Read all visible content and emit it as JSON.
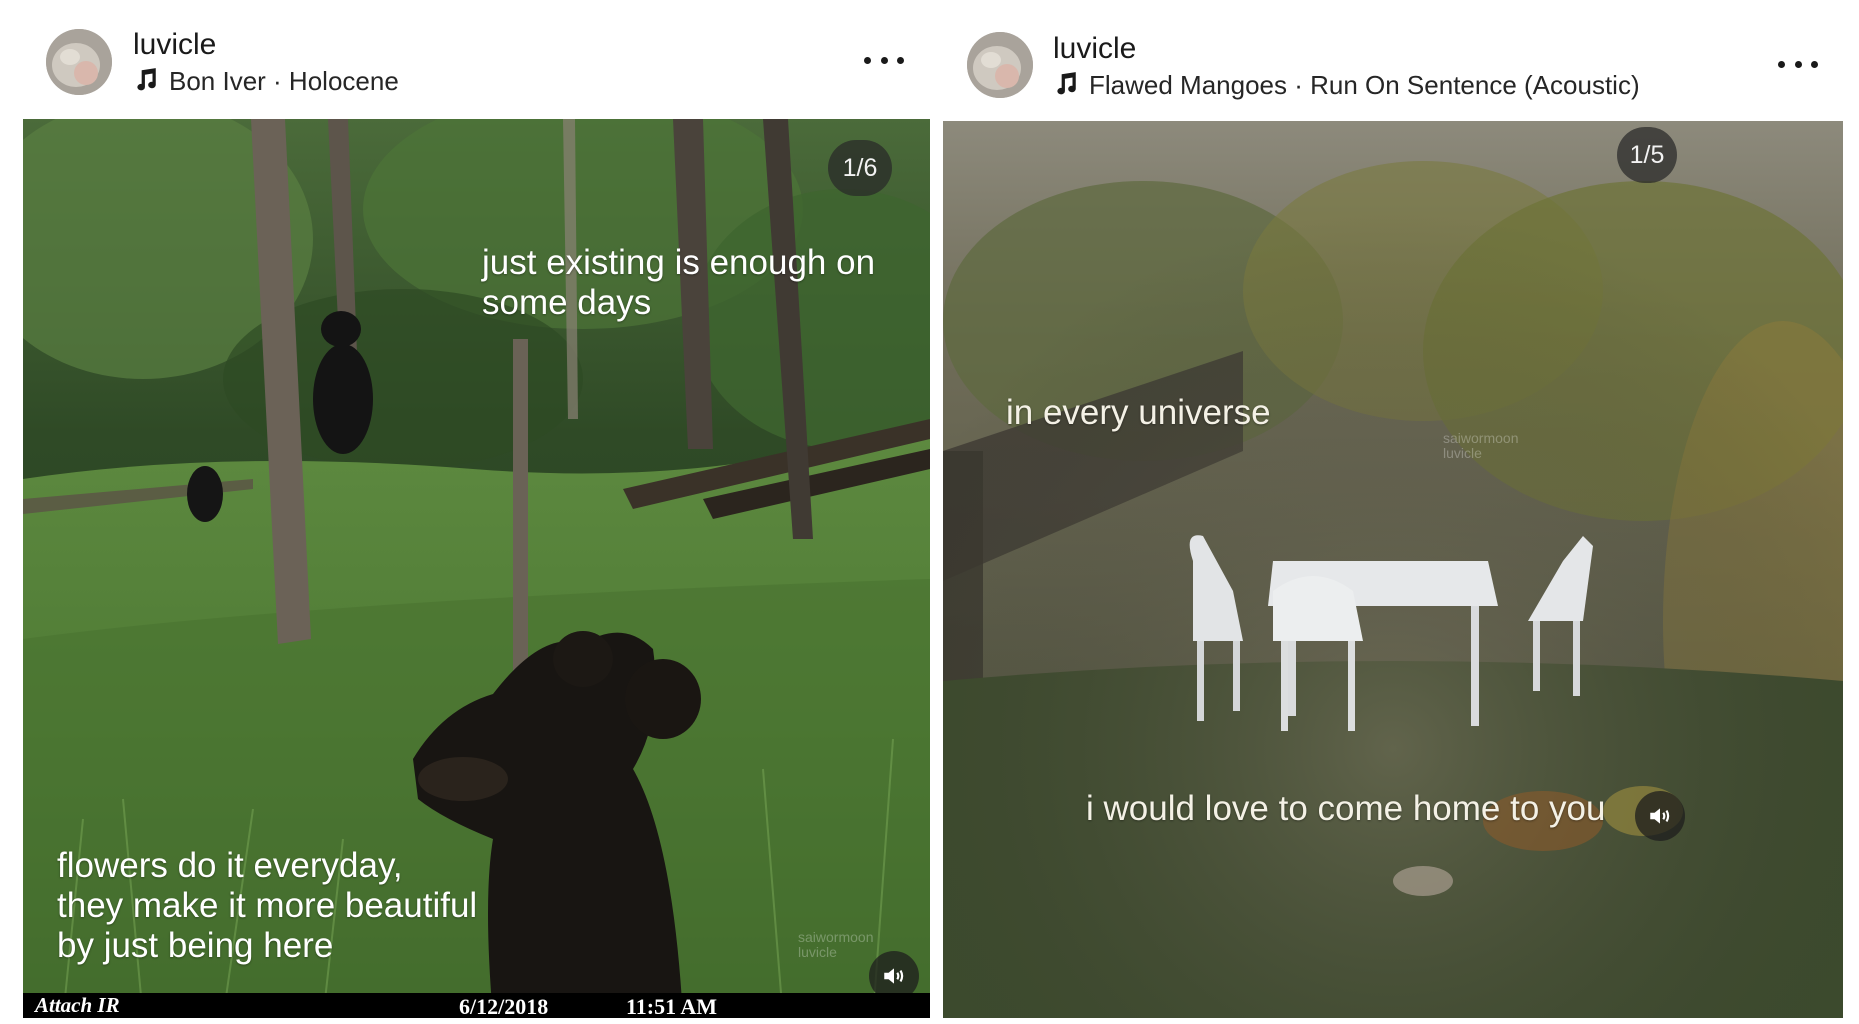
{
  "posts": [
    {
      "username": "luvicle",
      "music": "Bon Iver · Holocene",
      "counter": "1/6",
      "caption_top": "just existing is enough on\nsome days",
      "caption_bottom": "flowers do it everyday,\nthey make it more beautiful\nby just being here",
      "watermark": "saiwormoon\nluvicle",
      "camera_brand": "Attach IR",
      "camera_date": "6/12/2018",
      "camera_time": "11:51 AM",
      "icons": [
        "avatar",
        "music-note-icon",
        "more-options-icon",
        "sound-on-icon"
      ]
    },
    {
      "username": "luvicle",
      "music": "Flawed Mangoes · Run On Sentence (Acoustic)",
      "counter": "1/5",
      "caption_top": "in every universe",
      "caption_bottom": "i would love to come home to you",
      "watermark": "saiwormoon\nluvicle",
      "icons": [
        "avatar",
        "music-note-icon",
        "more-options-icon",
        "sound-on-icon"
      ]
    }
  ],
  "colors": {
    "text_primary": "#1a1a1a",
    "overlay_pill": "#282828",
    "caption_text": "#ffffff",
    "caption_text_warm": "#f4f1e6"
  }
}
